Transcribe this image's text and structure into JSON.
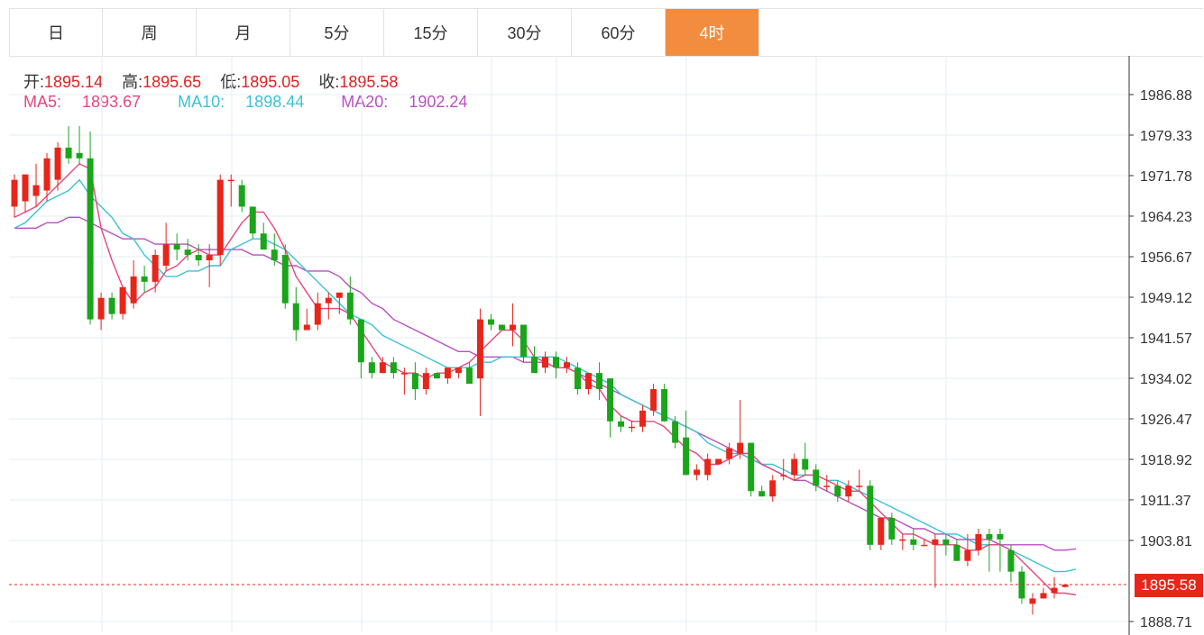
{
  "tabs": [
    {
      "label": "日",
      "active": false
    },
    {
      "label": "周",
      "active": false
    },
    {
      "label": "月",
      "active": false
    },
    {
      "label": "5分",
      "active": false
    },
    {
      "label": "15分",
      "active": false
    },
    {
      "label": "30分",
      "active": false
    },
    {
      "label": "60分",
      "active": false
    },
    {
      "label": "4时",
      "active": true
    }
  ],
  "ohlc": {
    "open_label": "开:",
    "open": "1895.14",
    "high_label": "高:",
    "high": "1895.65",
    "low_label": "低:",
    "low": "1895.05",
    "close_label": "收:",
    "close": "1895.58"
  },
  "ma": {
    "ma5_label": "MA5:",
    "ma5": "1893.67",
    "ma10_label": "MA10:",
    "ma10": "1898.44",
    "ma20_label": "MA20:",
    "ma20": "1902.24"
  },
  "colors": {
    "up": "#e8251a",
    "down": "#1aa51a",
    "ma5": "#e8467c",
    "ma10": "#3cc2d4",
    "ma20": "#b94fc3",
    "accent": "#f28c3e"
  },
  "current_price": "1895.58",
  "chart_data": {
    "type": "candlestick",
    "y_ticks": [
      "1986.88",
      "1979.33",
      "1971.78",
      "1964.23",
      "1956.67",
      "1949.12",
      "1941.57",
      "1934.02",
      "1926.47",
      "1918.92",
      "1911.37",
      "1903.81",
      "1888.71"
    ],
    "ylim": [
      1888.71,
      1986.88
    ],
    "candles": [
      {
        "o": 1966,
        "h": 1972,
        "l": 1964,
        "c": 1971
      },
      {
        "o": 1967,
        "h": 1972,
        "l": 1965,
        "c": 1972
      },
      {
        "o": 1968,
        "h": 1974,
        "l": 1966,
        "c": 1970
      },
      {
        "o": 1969,
        "h": 1976,
        "l": 1967,
        "c": 1975
      },
      {
        "o": 1971,
        "h": 1978,
        "l": 1969,
        "c": 1977
      },
      {
        "o": 1977,
        "h": 1981,
        "l": 1974,
        "c": 1975
      },
      {
        "o": 1976,
        "h": 1981,
        "l": 1974,
        "c": 1975
      },
      {
        "o": 1975,
        "h": 1980,
        "l": 1944,
        "c": 1945
      },
      {
        "o": 1945,
        "h": 1950,
        "l": 1943,
        "c": 1949
      },
      {
        "o": 1949,
        "h": 1950,
        "l": 1945,
        "c": 1946
      },
      {
        "o": 1946,
        "h": 1951,
        "l": 1945,
        "c": 1951
      },
      {
        "o": 1948,
        "h": 1956,
        "l": 1947,
        "c": 1953
      },
      {
        "o": 1953,
        "h": 1955,
        "l": 1950,
        "c": 1952
      },
      {
        "o": 1952,
        "h": 1958,
        "l": 1950,
        "c": 1957
      },
      {
        "o": 1955,
        "h": 1963,
        "l": 1954,
        "c": 1959
      },
      {
        "o": 1959,
        "h": 1961,
        "l": 1956,
        "c": 1958
      },
      {
        "o": 1958,
        "h": 1960,
        "l": 1956,
        "c": 1957
      },
      {
        "o": 1957,
        "h": 1959,
        "l": 1955,
        "c": 1956
      },
      {
        "o": 1956,
        "h": 1959,
        "l": 1951,
        "c": 1957
      },
      {
        "o": 1957,
        "h": 1972,
        "l": 1955,
        "c": 1971
      },
      {
        "o": 1971,
        "h": 1972,
        "l": 1966,
        "c": 1971
      },
      {
        "o": 1970,
        "h": 1971,
        "l": 1965,
        "c": 1966
      },
      {
        "o": 1966,
        "h": 1966,
        "l": 1960,
        "c": 1961
      },
      {
        "o": 1961,
        "h": 1963,
        "l": 1958,
        "c": 1958
      },
      {
        "o": 1958,
        "h": 1961,
        "l": 1955,
        "c": 1956
      },
      {
        "o": 1957,
        "h": 1959,
        "l": 1947,
        "c": 1948
      },
      {
        "o": 1948,
        "h": 1951,
        "l": 1941,
        "c": 1943
      },
      {
        "o": 1943,
        "h": 1947,
        "l": 1943,
        "c": 1944
      },
      {
        "o": 1944,
        "h": 1950,
        "l": 1943,
        "c": 1948
      },
      {
        "o": 1948,
        "h": 1950,
        "l": 1945,
        "c": 1949
      },
      {
        "o": 1949,
        "h": 1950,
        "l": 1946,
        "c": 1950
      },
      {
        "o": 1950,
        "h": 1953,
        "l": 1944,
        "c": 1945
      },
      {
        "o": 1945,
        "h": 1945,
        "l": 1934,
        "c": 1937
      },
      {
        "o": 1937,
        "h": 1938,
        "l": 1934,
        "c": 1935
      },
      {
        "o": 1935,
        "h": 1938,
        "l": 1935,
        "c": 1937
      },
      {
        "o": 1937,
        "h": 1938,
        "l": 1934,
        "c": 1935
      },
      {
        "o": 1935,
        "h": 1936,
        "l": 1931,
        "c": 1935
      },
      {
        "o": 1935,
        "h": 1937,
        "l": 1930,
        "c": 1932
      },
      {
        "o": 1932,
        "h": 1936,
        "l": 1931,
        "c": 1935
      },
      {
        "o": 1935,
        "h": 1935,
        "l": 1934,
        "c": 1934
      },
      {
        "o": 1934,
        "h": 1936,
        "l": 1933,
        "c": 1936
      },
      {
        "o": 1935,
        "h": 1936,
        "l": 1934,
        "c": 1936
      },
      {
        "o": 1936,
        "h": 1937,
        "l": 1933,
        "c": 1933
      },
      {
        "o": 1934,
        "h": 1947,
        "l": 1927,
        "c": 1945
      },
      {
        "o": 1945,
        "h": 1946,
        "l": 1943,
        "c": 1944
      },
      {
        "o": 1944,
        "h": 1944,
        "l": 1943,
        "c": 1943
      },
      {
        "o": 1943,
        "h": 1948,
        "l": 1940,
        "c": 1944
      },
      {
        "o": 1944,
        "h": 1944,
        "l": 1937,
        "c": 1938
      },
      {
        "o": 1938,
        "h": 1940,
        "l": 1935,
        "c": 1935
      },
      {
        "o": 1936,
        "h": 1939,
        "l": 1935,
        "c": 1938
      },
      {
        "o": 1938,
        "h": 1939,
        "l": 1934,
        "c": 1936
      },
      {
        "o": 1936,
        "h": 1938,
        "l": 1935,
        "c": 1937
      },
      {
        "o": 1936,
        "h": 1937,
        "l": 1931,
        "c": 1932
      },
      {
        "o": 1932,
        "h": 1935,
        "l": 1931,
        "c": 1935
      },
      {
        "o": 1935,
        "h": 1937,
        "l": 1930,
        "c": 1932
      },
      {
        "o": 1934,
        "h": 1934,
        "l": 1923,
        "c": 1926
      },
      {
        "o": 1926,
        "h": 1927,
        "l": 1924,
        "c": 1925
      },
      {
        "o": 1925,
        "h": 1926,
        "l": 1924,
        "c": 1925
      },
      {
        "o": 1925,
        "h": 1929,
        "l": 1924,
        "c": 1928
      },
      {
        "o": 1928,
        "h": 1933,
        "l": 1927,
        "c": 1932
      },
      {
        "o": 1932,
        "h": 1933,
        "l": 1926,
        "c": 1926
      },
      {
        "o": 1926,
        "h": 1927,
        "l": 1921,
        "c": 1922
      },
      {
        "o": 1923,
        "h": 1928,
        "l": 1916,
        "c": 1916
      },
      {
        "o": 1916,
        "h": 1918,
        "l": 1915,
        "c": 1917
      },
      {
        "o": 1916,
        "h": 1920,
        "l": 1915,
        "c": 1919
      },
      {
        "o": 1918,
        "h": 1919,
        "l": 1918,
        "c": 1919
      },
      {
        "o": 1919,
        "h": 1922,
        "l": 1918,
        "c": 1921
      },
      {
        "o": 1920,
        "h": 1930,
        "l": 1919,
        "c": 1922
      },
      {
        "o": 1922,
        "h": 1922,
        "l": 1912,
        "c": 1913
      },
      {
        "o": 1913,
        "h": 1914,
        "l": 1912,
        "c": 1912
      },
      {
        "o": 1912,
        "h": 1916,
        "l": 1911,
        "c": 1915
      },
      {
        "o": 1916,
        "h": 1919,
        "l": 1915,
        "c": 1916
      },
      {
        "o": 1916,
        "h": 1920,
        "l": 1915,
        "c": 1919
      },
      {
        "o": 1919,
        "h": 1922,
        "l": 1916,
        "c": 1917
      },
      {
        "o": 1917,
        "h": 1918,
        "l": 1913,
        "c": 1914
      },
      {
        "o": 1914,
        "h": 1916,
        "l": 1913,
        "c": 1914
      },
      {
        "o": 1914,
        "h": 1915,
        "l": 1911,
        "c": 1912
      },
      {
        "o": 1912,
        "h": 1915,
        "l": 1911,
        "c": 1914
      },
      {
        "o": 1914,
        "h": 1917,
        "l": 1913,
        "c": 1914
      },
      {
        "o": 1914,
        "h": 1915,
        "l": 1902,
        "c": 1903
      },
      {
        "o": 1903,
        "h": 1907,
        "l": 1902,
        "c": 1908
      },
      {
        "o": 1908,
        "h": 1909,
        "l": 1903,
        "c": 1904
      },
      {
        "o": 1904,
        "h": 1905,
        "l": 1902,
        "c": 1904
      },
      {
        "o": 1904,
        "h": 1906,
        "l": 1902,
        "c": 1903
      },
      {
        "o": 1903,
        "h": 1904,
        "l": 1903,
        "c": 1903
      },
      {
        "o": 1903,
        "h": 1905,
        "l": 1895,
        "c": 1904
      },
      {
        "o": 1904,
        "h": 1905,
        "l": 1901,
        "c": 1903
      },
      {
        "o": 1903,
        "h": 1904,
        "l": 1900,
        "c": 1900
      },
      {
        "o": 1900,
        "h": 1905,
        "l": 1899,
        "c": 1902
      },
      {
        "o": 1902,
        "h": 1906,
        "l": 1901,
        "c": 1905
      },
      {
        "o": 1905,
        "h": 1906,
        "l": 1898,
        "c": 1904
      },
      {
        "o": 1905,
        "h": 1906,
        "l": 1898,
        "c": 1904
      },
      {
        "o": 1902,
        "h": 1903,
        "l": 1896,
        "c": 1898
      },
      {
        "o": 1898,
        "h": 1899,
        "l": 1892,
        "c": 1893
      },
      {
        "o": 1892,
        "h": 1894,
        "l": 1890,
        "c": 1893
      },
      {
        "o": 1893,
        "h": 1895,
        "l": 1893,
        "c": 1894
      },
      {
        "o": 1894,
        "h": 1897,
        "l": 1893,
        "c": 1895
      },
      {
        "o": 1895.14,
        "h": 1895.65,
        "l": 1895.05,
        "c": 1895.58
      }
    ],
    "ma5": [
      1964,
      1965,
      1966,
      1968,
      1970,
      1972,
      1974,
      1973,
      1962,
      1956,
      1951,
      1948,
      1950,
      1951,
      1954,
      1955,
      1957,
      1958,
      1957,
      1957,
      1960,
      1963,
      1965,
      1965,
      1962,
      1958,
      1953,
      1950,
      1947,
      1947,
      1947,
      1946,
      1943,
      1940,
      1937,
      1936,
      1935,
      1935,
      1934,
      1935,
      1935,
      1936,
      1937,
      1939,
      1941,
      1943,
      1943,
      1941,
      1938,
      1937,
      1936,
      1936,
      1935,
      1933,
      1932,
      1929,
      1927,
      1926,
      1926,
      1926,
      1925,
      1923,
      1921,
      1920,
      1918,
      1918,
      1919,
      1920,
      1920,
      1918,
      1917,
      1916,
      1915,
      1916,
      1916,
      1915,
      1914,
      1913,
      1913,
      1911,
      1909,
      1907,
      1905,
      1905,
      1904,
      1903,
      1903,
      1903,
      1902,
      1902,
      1903,
      1903,
      1902,
      1900,
      1898,
      1896,
      1894,
      1894,
      1893.67
    ],
    "ma10": [
      1962,
      1963,
      1965,
      1967,
      1968,
      1969,
      1971,
      1968,
      1966,
      1964,
      1961,
      1960,
      1957,
      1955,
      1953,
      1953,
      1954,
      1954,
      1955,
      1955,
      1958,
      1959,
      1960,
      1960,
      1959,
      1958,
      1956,
      1954,
      1952,
      1950,
      1948,
      1946,
      1945,
      1944,
      1942,
      1941,
      1940,
      1939,
      1938,
      1937,
      1936,
      1936,
      1936,
      1937,
      1937,
      1938,
      1938,
      1938,
      1938,
      1938,
      1938,
      1937,
      1936,
      1935,
      1934,
      1933,
      1931,
      1930,
      1929,
      1928,
      1927,
      1926,
      1925,
      1924,
      1922,
      1921,
      1920,
      1920,
      1919,
      1918,
      1918,
      1917,
      1916,
      1916,
      1916,
      1915,
      1915,
      1914,
      1913,
      1912,
      1911,
      1910,
      1909,
      1908,
      1907,
      1906,
      1905,
      1905,
      1904,
      1903,
      1903,
      1903,
      1902,
      1901,
      1900,
      1899,
      1898,
      1898,
      1898.44
    ],
    "ma20": [
      1962,
      1962,
      1962,
      1963,
      1963,
      1964,
      1964,
      1963,
      1962,
      1961,
      1960,
      1960,
      1960,
      1959,
      1959,
      1959,
      1959,
      1958,
      1958,
      1958,
      1958,
      1958,
      1957,
      1957,
      1956,
      1955,
      1955,
      1954,
      1954,
      1954,
      1953,
      1951,
      1950,
      1948,
      1947,
      1945,
      1944,
      1943,
      1942,
      1941,
      1940,
      1939,
      1939,
      1938,
      1938,
      1938,
      1938,
      1937,
      1937,
      1937,
      1936,
      1936,
      1935,
      1934,
      1933,
      1932,
      1931,
      1930,
      1929,
      1928,
      1927,
      1926,
      1925,
      1924,
      1923,
      1922,
      1921,
      1920,
      1919,
      1918,
      1917,
      1916,
      1915,
      1915,
      1914,
      1913,
      1912,
      1911,
      1910,
      1909,
      1908,
      1908,
      1907,
      1906,
      1906,
      1905,
      1905,
      1904,
      1904,
      1904,
      1904,
      1903,
      1903,
      1903,
      1903,
      1903,
      1902,
      1902,
      1902.24
    ]
  }
}
